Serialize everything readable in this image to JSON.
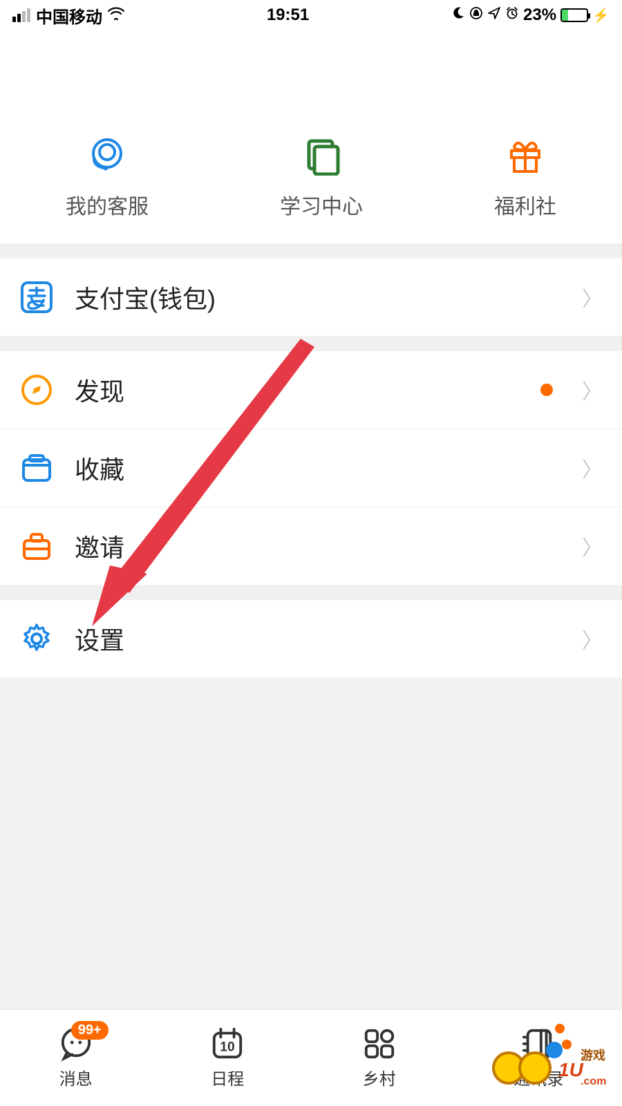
{
  "status": {
    "carrier": "中国移动",
    "time": "19:51",
    "battery_pct": "23%"
  },
  "quick_actions": [
    {
      "label": "我的客服",
      "icon": "headset-icon"
    },
    {
      "label": "学习中心",
      "icon": "book-icon"
    },
    {
      "label": "福利社",
      "icon": "gift-icon"
    }
  ],
  "menu": {
    "alipay_label": "支付宝(钱包)",
    "discover_label": "发现",
    "favorites_label": "收藏",
    "invite_label": "邀请",
    "settings_label": "设置"
  },
  "tabs": [
    {
      "label": "消息",
      "icon": "chat-icon",
      "badge": "99+"
    },
    {
      "label": "日程",
      "icon": "calendar-icon",
      "day": "10"
    },
    {
      "label": "乡村",
      "icon": "grid-icon"
    },
    {
      "label": "通讯录",
      "icon": "contacts-icon",
      "dot": true
    }
  ],
  "annotation": {
    "target": "settings"
  },
  "watermark_text": "001U.com"
}
